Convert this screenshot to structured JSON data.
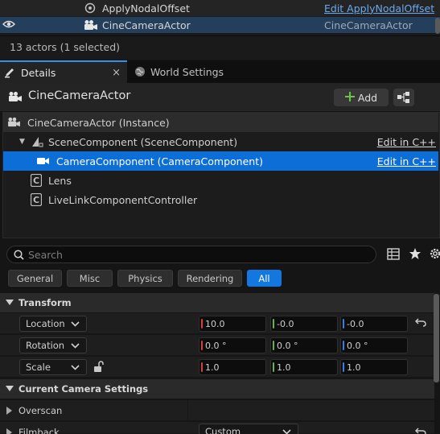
{
  "outliner": {
    "rows": [
      {
        "name": "ApplyNodalOffset",
        "type": "Edit ApplyNodalOffset",
        "type_is_link": true
      },
      {
        "name": "CineCameraActor",
        "type": "CineCameraActor",
        "type_is_link": false
      }
    ],
    "actor_count": "13 actors (1 selected)"
  },
  "tabs": {
    "details": "Details",
    "world_settings": "World Settings",
    "close_glyph": "×"
  },
  "details": {
    "actor_title": "CineCameraActor",
    "add_label": "Add"
  },
  "components": {
    "root": "CineCameraActor (Instance)",
    "items": [
      {
        "label": "SceneComponent (SceneComponent)",
        "edit": "Edit in C++"
      },
      {
        "label": "CameraComponent (CameraComponent)",
        "edit": "Edit in C++"
      },
      {
        "label": "Lens",
        "edit": ""
      },
      {
        "label": "LiveLinkComponentController",
        "edit": ""
      }
    ]
  },
  "search": {
    "placeholder": "Search"
  },
  "filters": [
    "General",
    "Misc",
    "Physics",
    "Rendering",
    "All"
  ],
  "transform": {
    "section_label": "Transform",
    "location": {
      "label": "Location",
      "x": "10.0",
      "y": "-0.0",
      "z": "-0.0"
    },
    "rotation": {
      "label": "Rotation",
      "x": "0.0 °",
      "y": "0.0 °",
      "z": "0.0 °"
    },
    "scale": {
      "label": "Scale",
      "x": "1.0",
      "y": "1.0",
      "z": "1.0"
    }
  },
  "camera_settings": {
    "section_label": "Current Camera Settings",
    "overscan_label": "Overscan",
    "filmback_label": "Filmback",
    "filmback_value": "Custom"
  },
  "colors": {
    "accent": "#0c6ed6",
    "axis_x": "#d64040",
    "axis_y": "#6ab04c",
    "axis_z": "#3a7fe0",
    "add_plus": "#6cc24a"
  }
}
